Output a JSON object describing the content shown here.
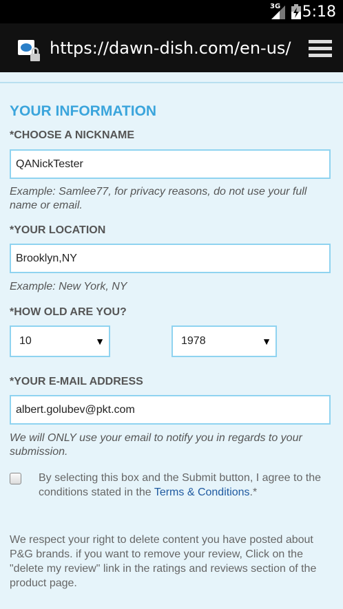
{
  "status_bar": {
    "network": "3G",
    "time": "5:18"
  },
  "browser": {
    "url": "https://dawn-dish.com/en-us/n"
  },
  "form": {
    "heading": "YOUR INFORMATION",
    "nickname": {
      "label": "*CHOOSE A NICKNAME",
      "value": "QANickTester",
      "hint": "Example: Samlee77, for privacy reasons, do not use your full name or email."
    },
    "location": {
      "label": "*YOUR LOCATION",
      "value": "Brooklyn,NY",
      "hint": "Example: New York, NY"
    },
    "age": {
      "label": "*HOW OLD ARE YOU?",
      "month_value": "10",
      "year_value": "1978"
    },
    "email": {
      "label": "*YOUR E-MAIL ADDRESS",
      "value": "albert.golubev@pkt.com",
      "hint": "We will ONLY use your email to notify you in regards to your submission."
    },
    "terms": {
      "checked": false,
      "text_before": "By selecting this box and the Submit button, I agree to the conditions stated in the ",
      "link": "Terms & Conditions",
      "text_after": ".*"
    },
    "footer_note": "We respect your right to delete content you have posted about P&G brands. if you want to remove your review, Click on the \"delete my review\" link in the ratings and reviews section of the product page."
  }
}
